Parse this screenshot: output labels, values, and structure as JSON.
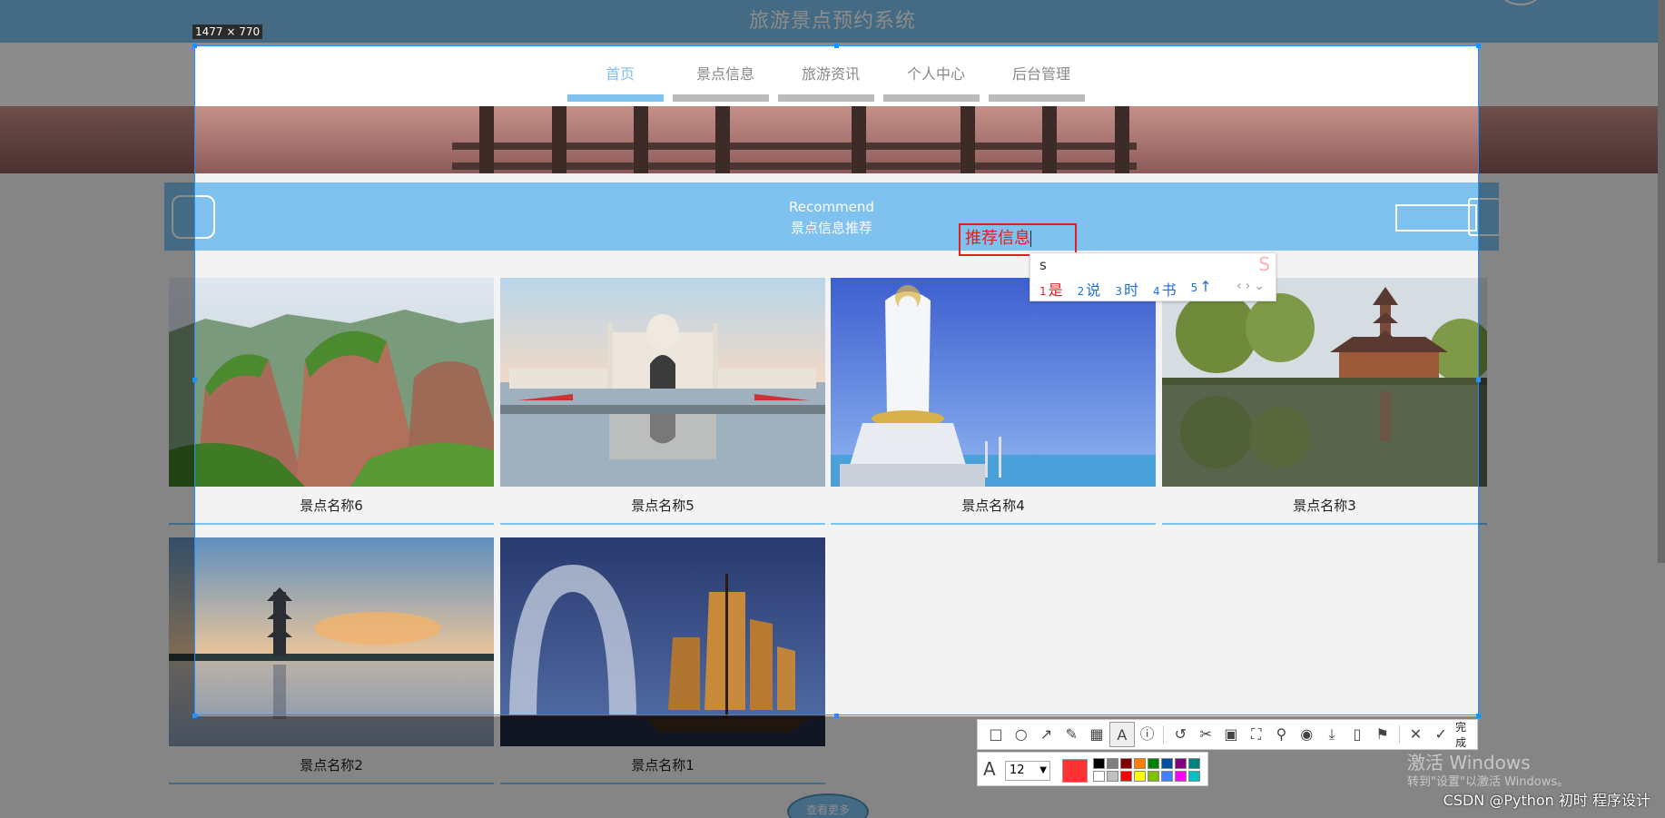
{
  "site": {
    "title": "旅游景点预约系统",
    "nav": [
      {
        "label": "首页",
        "active": true
      },
      {
        "label": "景点信息",
        "active": false
      },
      {
        "label": "旅游资讯",
        "active": false
      },
      {
        "label": "个人中心",
        "active": false
      },
      {
        "label": "后台管理",
        "active": false
      }
    ],
    "recommend": {
      "title_en": "Recommend",
      "title_cn": "景点信息推荐"
    },
    "cards": [
      {
        "name": "景点名称6",
        "scene": "mountain"
      },
      {
        "name": "景点名称5",
        "scene": "mosque"
      },
      {
        "name": "景点名称4",
        "scene": "statue"
      },
      {
        "name": "景点名称3",
        "scene": "pagoda-lake"
      },
      {
        "name": "景点名称2",
        "scene": "pagoda-sunset"
      },
      {
        "name": "景点名称1",
        "scene": "sailboats"
      }
    ],
    "more_label": "查看更多"
  },
  "capture": {
    "size_label": "1477 × 770",
    "text_annotation": "推荐信息",
    "ime": {
      "input": "s",
      "candidates": [
        {
          "num": "1",
          "text": "是"
        },
        {
          "num": "2",
          "text": "说"
        },
        {
          "num": "3",
          "text": "时"
        },
        {
          "num": "4",
          "text": "书"
        },
        {
          "num": "5",
          "text": "↑"
        }
      ]
    },
    "toolbar": {
      "tools": [
        "rectangle-icon",
        "ellipse-icon",
        "arrow-icon",
        "pen-icon",
        "mosaic-icon",
        "text-icon",
        "serial-number-icon",
        "undo-icon",
        "cut-icon",
        "ocr-icon",
        "scroll-capture-icon",
        "pin-icon",
        "record-icon",
        "download-icon",
        "long-screenshot-icon",
        "bookmark-icon",
        "close-icon"
      ],
      "done_label": "完成"
    },
    "props": {
      "font_size": "12",
      "current_color": "#ff3333",
      "swatches": [
        "#000000",
        "#808080",
        "#800000",
        "#ff8000",
        "#008000",
        "#0050a0",
        "#800080",
        "#008080",
        "#ffffff",
        "#c0c0c0",
        "#ff0000",
        "#ffff00",
        "#80c000",
        "#4080ff",
        "#ff00ff",
        "#00c0c0"
      ]
    }
  },
  "os": {
    "activate_title": "激活 Windows",
    "activate_sub": "转到\"设置\"以激活 Windows。",
    "watermark": "CSDN @Python 初时 程序设计"
  }
}
